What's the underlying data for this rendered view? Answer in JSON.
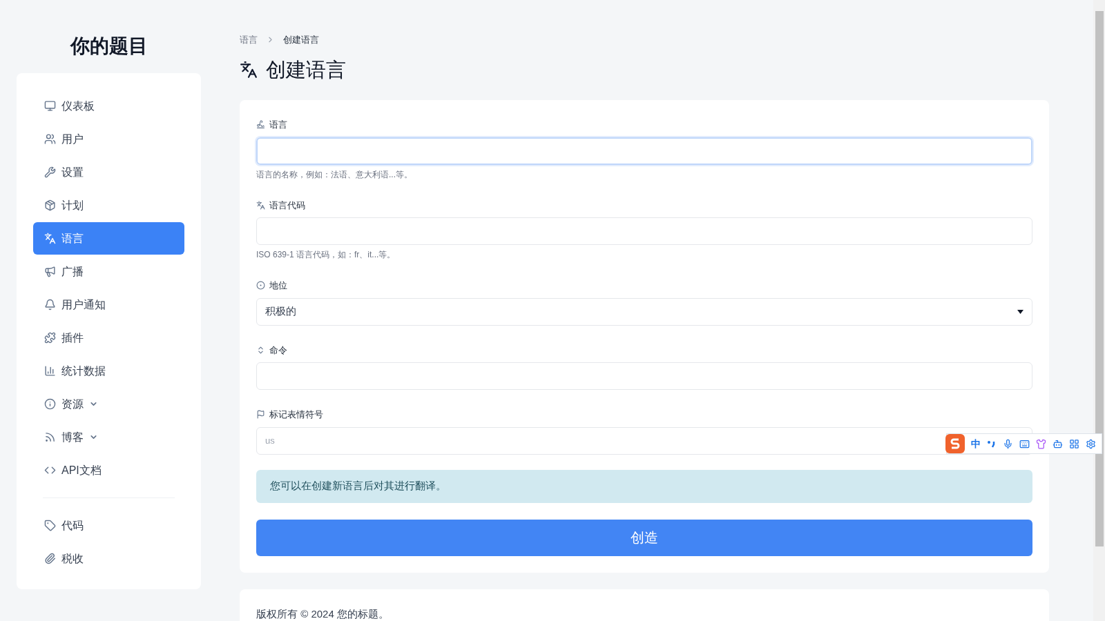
{
  "brand": "你的题目",
  "sidebar": {
    "items": [
      {
        "label": "仪表板",
        "selected": false,
        "dropdown": false
      },
      {
        "label": "用户",
        "selected": false,
        "dropdown": false
      },
      {
        "label": "设置",
        "selected": false,
        "dropdown": false
      },
      {
        "label": "计划",
        "selected": false,
        "dropdown": false
      },
      {
        "label": "语言",
        "selected": true,
        "dropdown": false
      },
      {
        "label": "广播",
        "selected": false,
        "dropdown": false
      },
      {
        "label": "用户通知",
        "selected": false,
        "dropdown": false
      },
      {
        "label": "插件",
        "selected": false,
        "dropdown": false
      },
      {
        "label": "统计数据",
        "selected": false,
        "dropdown": false
      },
      {
        "label": "资源",
        "selected": false,
        "dropdown": true
      },
      {
        "label": "博客",
        "selected": false,
        "dropdown": true
      },
      {
        "label": "API文档",
        "selected": false,
        "dropdown": false
      }
    ],
    "items_2": [
      {
        "label": "代码",
        "selected": false,
        "dropdown": false
      },
      {
        "label": "税收",
        "selected": false,
        "dropdown": false
      }
    ]
  },
  "breadcrumb": [
    "语言",
    "创建语言"
  ],
  "page_title": "创建语言",
  "form": {
    "fields": [
      {
        "kind": "text",
        "label": "语言",
        "focused": true,
        "help": "语言的名称，例如：法语、意大利语...等。"
      },
      {
        "kind": "text",
        "label": "语言代码",
        "focused": false,
        "help": "ISO 639-1 语言代码，如：fr、it...等。"
      },
      {
        "kind": "select",
        "label": "地位",
        "value": "积极的"
      },
      {
        "kind": "text",
        "label": "命令",
        "focused": false
      },
      {
        "kind": "text",
        "label": "标记表情符号",
        "focused": false,
        "placeholder": "us"
      }
    ],
    "notice": "您可以在创建新语言后对其进行翻译。",
    "submit": "创造"
  },
  "footer": "版权所有 © 2024 您的标题。",
  "ime_toolbar": {
    "mode": "中"
  }
}
